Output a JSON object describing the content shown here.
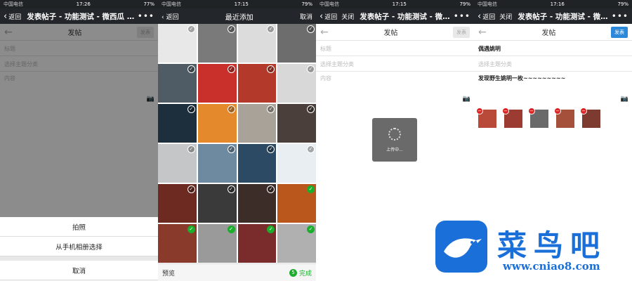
{
  "panel1": {
    "status": {
      "carrier": "中国电信",
      "time": "17:26",
      "battery": "77%"
    },
    "nav": {
      "back": "返回",
      "title": "发表帖子 - 功能测试 - 微西瓜 - 手..."
    },
    "header": {
      "title": "发帖",
      "publish": "发表"
    },
    "fields": {
      "title_placeholder": "标题",
      "category_placeholder": "选择主题分类",
      "content_placeholder": "内容"
    },
    "sheet": {
      "take_photo": "拍照",
      "from_album": "从手机相册选择",
      "cancel": "取消"
    }
  },
  "panel2": {
    "status": {
      "carrier": "中国电信",
      "time": "17:15",
      "battery": "79%"
    },
    "nav": {
      "back": "返回",
      "title": "最近添加",
      "cancel": "取消"
    },
    "footer": {
      "preview": "预览",
      "count": "5",
      "done": "完成"
    },
    "tiles": [
      {
        "bg": "#e8e8e8",
        "checked": false
      },
      {
        "bg": "#7a7a7a",
        "checked": false
      },
      {
        "bg": "#dcdcdc",
        "checked": false
      },
      {
        "bg": "#6d6d6d",
        "checked": false
      },
      {
        "bg": "#4f5c66",
        "checked": false
      },
      {
        "bg": "#c9302c",
        "checked": false
      },
      {
        "bg": "#b33a2a",
        "checked": false
      },
      {
        "bg": "#d8d8d8",
        "checked": false
      },
      {
        "bg": "#1d2f3c",
        "checked": false
      },
      {
        "bg": "#e58a2c",
        "checked": false
      },
      {
        "bg": "#a8a298",
        "checked": false
      },
      {
        "bg": "#4a3f3a",
        "checked": false
      },
      {
        "bg": "#c4c6c8",
        "checked": false
      },
      {
        "bg": "#6d8aa0",
        "checked": false
      },
      {
        "bg": "#2c4a63",
        "checked": false
      },
      {
        "bg": "#e9eef2",
        "checked": false
      },
      {
        "bg": "#6c2a20",
        "checked": false
      },
      {
        "bg": "#3a3a3a",
        "checked": false
      },
      {
        "bg": "#3d2d28",
        "checked": false
      },
      {
        "bg": "#b9571d",
        "checked": true
      },
      {
        "bg": "#8a3a2a",
        "checked": true
      },
      {
        "bg": "#9a9a9a",
        "checked": true
      },
      {
        "bg": "#7a2c2c",
        "checked": true
      },
      {
        "bg": "#b0b0b0",
        "checked": true
      }
    ]
  },
  "panel3": {
    "status": {
      "carrier": "中国电信",
      "time": "17:15",
      "battery": "79%"
    },
    "nav": {
      "back": "返回",
      "close": "关闭",
      "title": "发表帖子 - 功能测试 - 微西瓜..."
    },
    "header": {
      "title": "发帖",
      "publish": "发表"
    },
    "fields": {
      "title_placeholder": "标题",
      "category_placeholder": "选择主题分类",
      "content_placeholder": "内容"
    },
    "toast": "上传中..."
  },
  "panel4": {
    "status": {
      "carrier": "中国电信",
      "time": "17:16",
      "battery": "79%"
    },
    "nav": {
      "back": "返回",
      "close": "关闭",
      "title": "发表帖子 - 功能测试 - 微西瓜..."
    },
    "header": {
      "title": "发帖",
      "publish": "发表"
    },
    "fields": {
      "title_value": "偶遇姚明",
      "category_placeholder": "选择主题分类",
      "content_value": "发现野生姚明一枚~~~~~~~~~"
    },
    "thumbs": [
      "#b94a3a",
      "#9c3b32",
      "#6a6a6a",
      "#a5503a",
      "#7d3a2e"
    ]
  },
  "watermark": {
    "name": "菜鸟吧",
    "url": "www.cniao8.com",
    "color": "#1b6fd8"
  }
}
